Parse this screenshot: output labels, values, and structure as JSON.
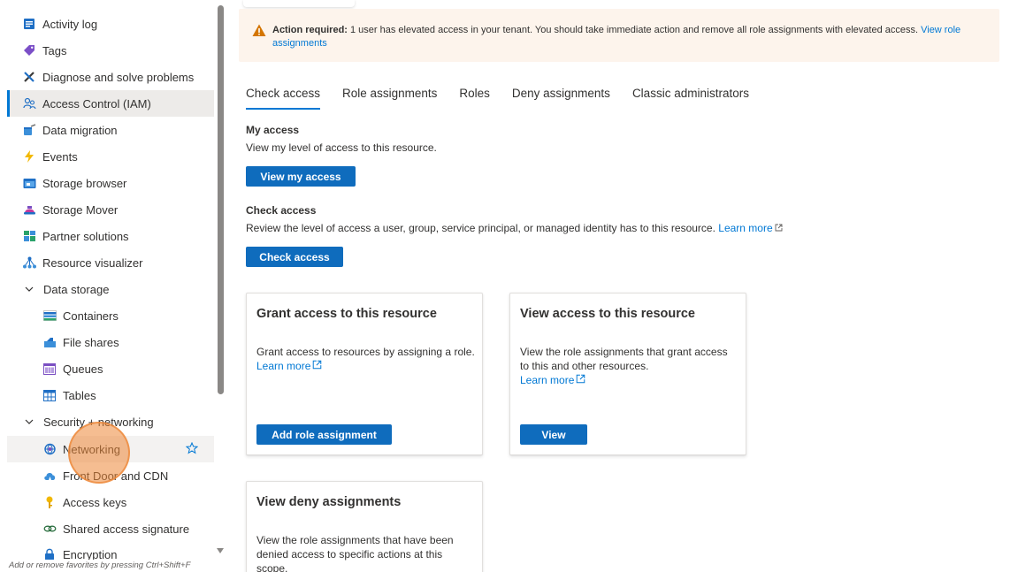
{
  "sidebar": {
    "items": [
      {
        "label": "Activity log",
        "icon": "activity-log-icon"
      },
      {
        "label": "Tags",
        "icon": "tag-icon"
      },
      {
        "label": "Diagnose and solve problems",
        "icon": "wrench-icon"
      },
      {
        "label": "Access Control (IAM)",
        "icon": "people-icon"
      },
      {
        "label": "Data migration",
        "icon": "data-migration-icon"
      },
      {
        "label": "Events",
        "icon": "lightning-icon"
      },
      {
        "label": "Storage browser",
        "icon": "storage-browser-icon"
      },
      {
        "label": "Storage Mover",
        "icon": "storage-mover-icon"
      },
      {
        "label": "Partner solutions",
        "icon": "partner-solutions-icon"
      },
      {
        "label": "Resource visualizer",
        "icon": "resource-visualizer-icon"
      },
      {
        "label": "Data storage",
        "icon": "chevron-down-icon"
      },
      {
        "label": "Containers",
        "icon": "containers-icon"
      },
      {
        "label": "File shares",
        "icon": "file-shares-icon"
      },
      {
        "label": "Queues",
        "icon": "queues-icon"
      },
      {
        "label": "Tables",
        "icon": "tables-icon"
      },
      {
        "label": "Security + networking",
        "icon": "chevron-down-icon"
      },
      {
        "label": "Networking",
        "icon": "networking-icon"
      },
      {
        "label": "Front Door and CDN",
        "icon": "cloud-icon"
      },
      {
        "label": "Access keys",
        "icon": "key-icon"
      },
      {
        "label": "Shared access signature",
        "icon": "link-icon"
      },
      {
        "label": "Encryption",
        "icon": "lock-icon"
      }
    ],
    "footer": "Add or remove favorites by pressing Ctrl+Shift+F"
  },
  "banner": {
    "bold": "Action required:",
    "text": " 1 user has elevated access in your tenant. You should take immediate action and remove all role assignments with elevated access. ",
    "link": "View role assignments"
  },
  "tabs": [
    "Check access",
    "Role assignments",
    "Roles",
    "Deny assignments",
    "Classic administrators"
  ],
  "my_access": {
    "title": "My access",
    "desc": "View my level of access to this resource.",
    "button": "View my access"
  },
  "check_access": {
    "title": "Check access",
    "desc": "Review the level of access a user, group, service principal, or managed identity has to this resource.",
    "link": "Learn more",
    "button": "Check access"
  },
  "cards": {
    "grant": {
      "title": "Grant access to this resource",
      "desc": "Grant access to resources by assigning a role.",
      "link": "Learn more",
      "button": "Add role assignment"
    },
    "view": {
      "title": "View access to this resource",
      "desc": "View the role assignments that grant access to this and other resources.",
      "link": "Learn more",
      "button": "View"
    },
    "deny": {
      "title": "View deny assignments",
      "desc": "View the role assignments that have been denied access to specific actions at this scope."
    }
  },
  "colors": {
    "accent": "#0078d4",
    "button": "#0f6cbd",
    "banner_bg": "#fdf4ec",
    "warning": "#d47500"
  }
}
